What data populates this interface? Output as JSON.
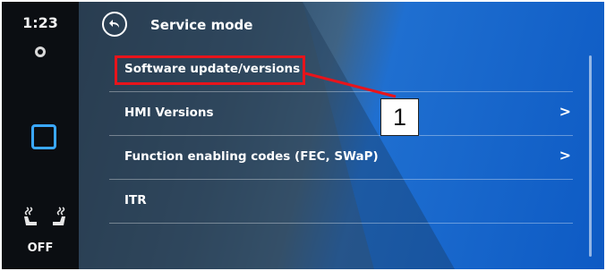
{
  "rail": {
    "time": "1:23",
    "seat_status": "OFF"
  },
  "header": {
    "title": "Service mode"
  },
  "menu": {
    "items": [
      {
        "label": "Software update/versions",
        "has_chevron": false,
        "highlighted": true
      },
      {
        "label": "HMI Versions",
        "chevron": ">",
        "has_chevron": true
      },
      {
        "label": "Function enabling codes (FEC, SWaP)",
        "chevron": ">",
        "has_chevron": true
      },
      {
        "label": "ITR",
        "has_chevron": false
      }
    ]
  },
  "annotation": {
    "callout_number": "1",
    "color": "#e8141b"
  },
  "colors": {
    "accent_square": "#3aa8ff",
    "screen_blue": "#0d5ac4"
  }
}
